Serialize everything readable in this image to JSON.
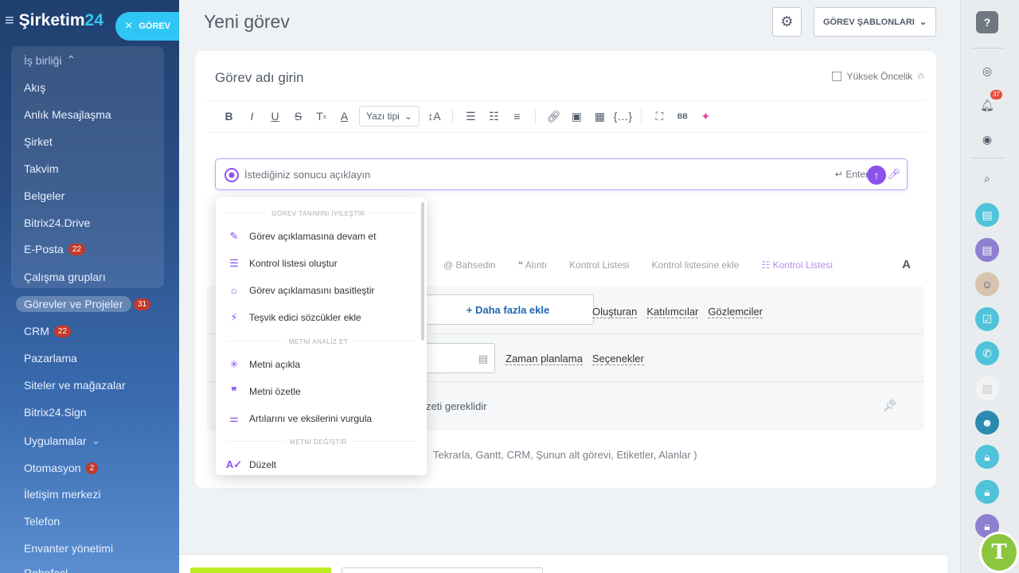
{
  "sidebar": {
    "brand": "Şirketim",
    "brand_num": "24",
    "task_pill": "GÖREV",
    "items": [
      {
        "label": "İş birliği",
        "badge": "",
        "chevron": "⌃"
      },
      {
        "label": "Akış",
        "badge": ""
      },
      {
        "label": "Anlık Mesajlaşma",
        "badge": ""
      },
      {
        "label": "Şirket",
        "badge": ""
      },
      {
        "label": "Takvim",
        "badge": ""
      },
      {
        "label": "Belgeler",
        "badge": ""
      },
      {
        "label": "Bitrix24.Drive",
        "badge": ""
      },
      {
        "label": "E-Posta",
        "badge": "22"
      },
      {
        "label": "Çalışma grupları",
        "badge": ""
      },
      {
        "label": "Görevler ve Projeler",
        "badge": "31"
      },
      {
        "label": "CRM",
        "badge": "22"
      },
      {
        "label": "Pazarlama",
        "badge": ""
      },
      {
        "label": "Siteler ve mağazalar",
        "badge": ""
      },
      {
        "label": "Bitrix24.Sign",
        "badge": ""
      },
      {
        "label": "Uygulamalar",
        "badge": "",
        "chevron": "⌄"
      },
      {
        "label": "Otomasyon",
        "badge": "2"
      },
      {
        "label": "İletişim merkezi",
        "badge": ""
      },
      {
        "label": "Telefon",
        "badge": ""
      },
      {
        "label": "Envanter yönetimi",
        "badge": ""
      },
      {
        "label": "Robofacl",
        "badge": ""
      }
    ]
  },
  "header": {
    "title": "Yeni görev",
    "templates_label": "GÖREV ŞABLONLARI"
  },
  "form": {
    "task_name_placeholder": "Görev adı girin",
    "high_priority": "Yüksek Öncelik",
    "font_select": "Yazı tipi",
    "ai_placeholder": "İstediğiniz sonucu açıklayın",
    "ai_enter": "Enter",
    "insert_row": {
      "mention": "Bahsedin",
      "quote": "Alıntı",
      "checklist": "Kontrol Listesi",
      "add_to_checklist": "Kontrol listesine ekle",
      "checklist_ai": "Kontrol Listesi"
    },
    "more_button": "Daha fazla ekle",
    "people_links": [
      "Oluşturan",
      "Katılımcılar",
      "Gözlemciler"
    ],
    "time_links": [
      "Zaman planlama",
      "Seçenekler"
    ],
    "required_text": "zeti gereklidir",
    "extras_text": "Tekrarla,  Gantt,  CRM,  Şunun alt görevi,  Etiketler,  Alanlar )"
  },
  "popup": {
    "section1": "GÖREV TANIMINI İYİLEŞTİR",
    "items1": [
      {
        "icon": "pen-icon",
        "label": "Görev açıklamasına devam et"
      },
      {
        "icon": "checklist-icon",
        "label": "Kontrol listesi oluştur"
      },
      {
        "icon": "sun-icon",
        "label": "Görev açıklamasını basitleştir"
      },
      {
        "icon": "bolt-icon",
        "label": "Teşvik edici sözcükler ekle"
      }
    ],
    "section2": "METNİ ANALİZ ET",
    "items2": [
      {
        "icon": "cursor-sparkle-icon",
        "label": "Metni açıkla"
      },
      {
        "icon": "quote-icon",
        "label": "Metni özetle"
      },
      {
        "icon": "sliders-icon",
        "label": "Artılarını ve eksilerini vurgula"
      }
    ],
    "section3": "METNİ DEĞİŞTİR",
    "items3": [
      {
        "icon": "text-check-icon",
        "label": "Düzelt"
      }
    ]
  },
  "rightbar": {
    "notifications_badge": "37"
  },
  "colors": {
    "accent": "#2fc6f6",
    "ai_purple": "#8e52ec",
    "save_green": "#bbed21"
  }
}
